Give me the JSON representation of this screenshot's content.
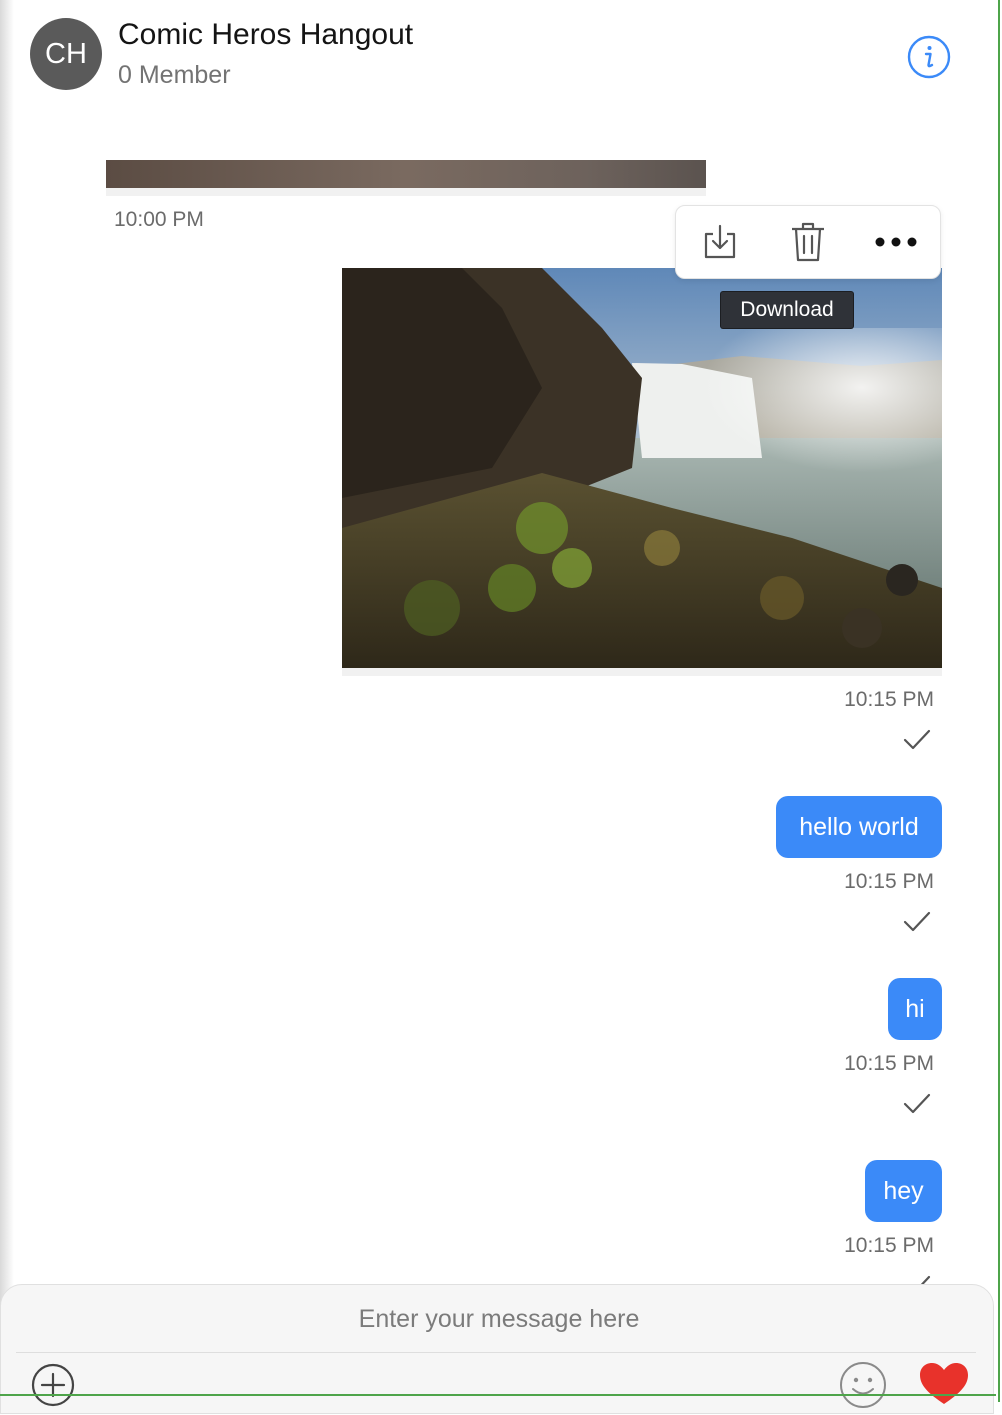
{
  "header": {
    "avatar_initials": "CH",
    "title": "Comic Heros Hangout",
    "subtitle": "0 Member",
    "info_icon": "info-icon"
  },
  "messages": {
    "prev_image_time": "10:00 PM",
    "image_message": {
      "time": "10:15 PM",
      "status_icon": "check-icon"
    },
    "text_messages": [
      {
        "text": "hello world",
        "time": "10:15 PM",
        "status_icon": "check-icon"
      },
      {
        "text": "hi",
        "time": "10:15 PM",
        "status_icon": "check-icon"
      },
      {
        "text": "hey",
        "time": "10:15 PM",
        "status_icon": "check-icon"
      }
    ]
  },
  "action_bar": {
    "icons": [
      "download-icon",
      "trash-icon",
      "more-icon"
    ],
    "tooltip": "Download"
  },
  "composer": {
    "placeholder": "Enter your message here",
    "icons": [
      "plus-circle-icon",
      "emoji-icon",
      "heart-icon"
    ]
  },
  "colors": {
    "accent": "#3b8af8",
    "heart": "#e8322b",
    "frame_border": "#4ea44a"
  }
}
